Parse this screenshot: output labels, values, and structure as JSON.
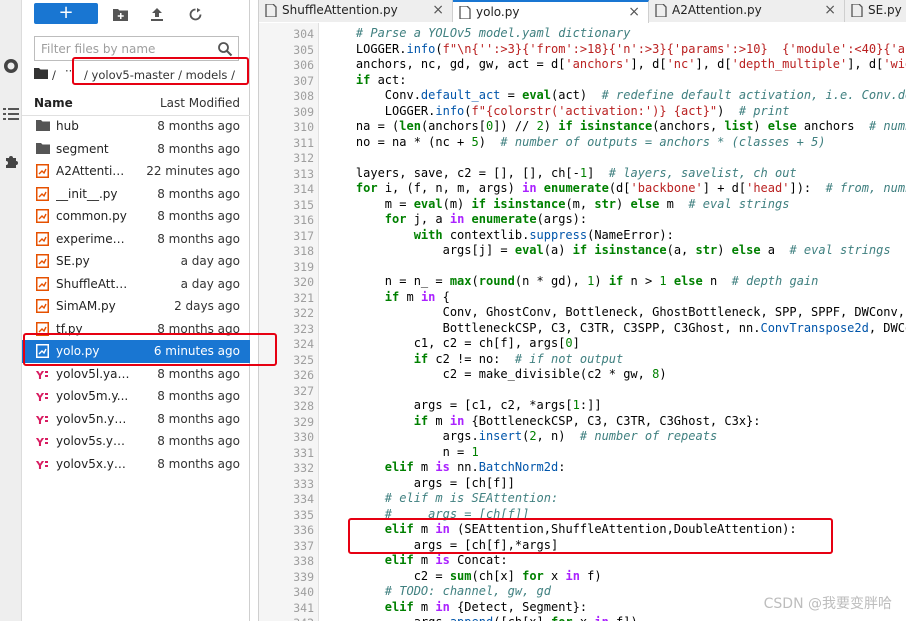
{
  "browser": {
    "search_placeholder": "Filter files by name",
    "breadcrumb": {
      "root": "/",
      "ellipsis": "··",
      "path": "/ yolov5-master / models /"
    },
    "header": {
      "name": "Name",
      "modified": "Last Modified"
    },
    "files": [
      {
        "name": "hub",
        "type": "folder",
        "modified": "8 months ago"
      },
      {
        "name": "segment",
        "type": "folder",
        "modified": "8 months ago"
      },
      {
        "name": "A2Attentio...",
        "type": "python",
        "modified": "22 minutes ago"
      },
      {
        "name": "__init__.py",
        "type": "python",
        "modified": "8 months ago"
      },
      {
        "name": "common.py",
        "type": "python",
        "modified": "8 months ago"
      },
      {
        "name": "experimen...",
        "type": "python",
        "modified": "8 months ago"
      },
      {
        "name": "SE.py",
        "type": "python",
        "modified": "a day ago"
      },
      {
        "name": "ShuffleAtte...",
        "type": "python",
        "modified": "a day ago"
      },
      {
        "name": "SimAM.py",
        "type": "python",
        "modified": "2 days ago"
      },
      {
        "name": "tf.py",
        "type": "python",
        "modified": "8 months ago"
      },
      {
        "name": "yolo.py",
        "type": "python",
        "modified": "6 minutes ago",
        "selected": true
      },
      {
        "name": "yolov5l.yaml",
        "type": "yaml",
        "modified": "8 months ago"
      },
      {
        "name": "yolov5m.y...",
        "type": "yaml",
        "modified": "8 months ago"
      },
      {
        "name": "yolov5n.yaml",
        "type": "yaml",
        "modified": "8 months ago"
      },
      {
        "name": "yolov5s.yaml",
        "type": "yaml",
        "modified": "8 months ago"
      },
      {
        "name": "yolov5x.yaml",
        "type": "yaml",
        "modified": "8 months ago"
      }
    ]
  },
  "editor": {
    "tabs": [
      {
        "label": "ShuffleAttention.py",
        "close": "×",
        "active": false
      },
      {
        "label": "yolo.py",
        "close": "×",
        "active": true
      },
      {
        "label": "A2Attention.py",
        "close": "×",
        "active": false
      },
      {
        "label": "SE.py",
        "close": "",
        "active": false
      }
    ],
    "lines": [
      {
        "n": "304",
        "segs": [
          [
            "    ",
            ""
          ],
          [
            "# Parse a YOLOv5 model.yaml dictionary",
            "cm"
          ]
        ]
      },
      {
        "n": "305",
        "segs": [
          [
            "    LOGGER.",
            ""
          ],
          [
            "info",
            "fn"
          ],
          [
            "(",
            ""
          ],
          [
            "f\"\\n{'':>3}{'from':>18}{'n':>3}{'params':>10}  {'module':<40}{'argumen",
            "st"
          ]
        ]
      },
      {
        "n": "306",
        "segs": [
          [
            "    anchors, nc, gd, gw, act = d[",
            ""
          ],
          [
            "'anchors'",
            "st"
          ],
          [
            "], d[",
            ""
          ],
          [
            "'nc'",
            "st"
          ],
          [
            "], d[",
            ""
          ],
          [
            "'depth_multiple'",
            "st"
          ],
          [
            "], d[",
            ""
          ],
          [
            "'width_mu",
            "st"
          ]
        ]
      },
      {
        "n": "307",
        "segs": [
          [
            "    ",
            ""
          ],
          [
            "if",
            "kw"
          ],
          [
            " act:",
            ""
          ]
        ]
      },
      {
        "n": "308",
        "segs": [
          [
            "        Conv.",
            ""
          ],
          [
            "default_act",
            "fn"
          ],
          [
            " = ",
            ""
          ],
          [
            "eval",
            "kw"
          ],
          [
            "(act)  ",
            ""
          ],
          [
            "# redefine default activation, i.e. Conv.default",
            "cm"
          ]
        ]
      },
      {
        "n": "309",
        "segs": [
          [
            "        LOGGER.",
            ""
          ],
          [
            "info",
            "fn"
          ],
          [
            "(",
            ""
          ],
          [
            "f\"{colorstr('activation:')} {act}\"",
            "st"
          ],
          [
            ")  ",
            ""
          ],
          [
            "# print",
            "cm"
          ]
        ]
      },
      {
        "n": "310",
        "segs": [
          [
            "    na = (",
            ""
          ],
          [
            "len",
            "kw"
          ],
          [
            "(anchors[",
            ""
          ],
          [
            "0",
            "nu"
          ],
          [
            "]) // ",
            ""
          ],
          [
            "2",
            "nu"
          ],
          [
            ") ",
            ""
          ],
          [
            "if",
            "kw"
          ],
          [
            " ",
            ""
          ],
          [
            "isinstance",
            "kw"
          ],
          [
            "(anchors, ",
            ""
          ],
          [
            "list",
            "kw"
          ],
          [
            ") ",
            ""
          ],
          [
            "else",
            "kw"
          ],
          [
            " anchors  ",
            ""
          ],
          [
            "# number o",
            "cm"
          ]
        ]
      },
      {
        "n": "311",
        "segs": [
          [
            "    no = na * (nc + ",
            ""
          ],
          [
            "5",
            "nu"
          ],
          [
            ")  ",
            ""
          ],
          [
            "# number of outputs = anchors * (classes + 5)",
            "cm"
          ]
        ]
      },
      {
        "n": "312",
        "segs": [
          [
            "",
            ""
          ]
        ]
      },
      {
        "n": "313",
        "segs": [
          [
            "    layers, save, c2 = [], [], ch[-",
            ""
          ],
          [
            "1",
            "nu"
          ],
          [
            "]  ",
            ""
          ],
          [
            "# layers, savelist, ch out",
            "cm"
          ]
        ]
      },
      {
        "n": "314",
        "segs": [
          [
            "    ",
            ""
          ],
          [
            "for",
            "kw"
          ],
          [
            " i, (f, n, m, args) ",
            ""
          ],
          [
            "in",
            "op"
          ],
          [
            " ",
            ""
          ],
          [
            "enumerate",
            "kw"
          ],
          [
            "(d[",
            ""
          ],
          [
            "'backbone'",
            "st"
          ],
          [
            "] + d[",
            ""
          ],
          [
            "'head'",
            "st"
          ],
          [
            "]):  ",
            ""
          ],
          [
            "# from, number, m",
            "cm"
          ]
        ]
      },
      {
        "n": "315",
        "segs": [
          [
            "        m = ",
            ""
          ],
          [
            "eval",
            "kw"
          ],
          [
            "(m) ",
            ""
          ],
          [
            "if",
            "kw"
          ],
          [
            " ",
            ""
          ],
          [
            "isinstance",
            "kw"
          ],
          [
            "(m, ",
            ""
          ],
          [
            "str",
            "kw"
          ],
          [
            ") ",
            ""
          ],
          [
            "else",
            "kw"
          ],
          [
            " m  ",
            ""
          ],
          [
            "# eval strings",
            "cm"
          ]
        ]
      },
      {
        "n": "316",
        "segs": [
          [
            "        ",
            ""
          ],
          [
            "for",
            "kw"
          ],
          [
            " j, a ",
            ""
          ],
          [
            "in",
            "op"
          ],
          [
            " ",
            ""
          ],
          [
            "enumerate",
            "kw"
          ],
          [
            "(args):",
            ""
          ]
        ]
      },
      {
        "n": "317",
        "segs": [
          [
            "            ",
            ""
          ],
          [
            "with",
            "kw"
          ],
          [
            " contextlib.",
            ""
          ],
          [
            "suppress",
            "fn"
          ],
          [
            "(NameError):",
            ""
          ]
        ]
      },
      {
        "n": "318",
        "segs": [
          [
            "                args[j] = ",
            ""
          ],
          [
            "eval",
            "kw"
          ],
          [
            "(a) ",
            ""
          ],
          [
            "if",
            "kw"
          ],
          [
            " ",
            ""
          ],
          [
            "isinstance",
            "kw"
          ],
          [
            "(a, ",
            ""
          ],
          [
            "str",
            "kw"
          ],
          [
            ") ",
            ""
          ],
          [
            "else",
            "kw"
          ],
          [
            " a  ",
            ""
          ],
          [
            "# eval strings",
            "cm"
          ]
        ]
      },
      {
        "n": "319",
        "segs": [
          [
            "",
            ""
          ]
        ]
      },
      {
        "n": "320",
        "segs": [
          [
            "        n = n_ = ",
            ""
          ],
          [
            "max",
            "kw"
          ],
          [
            "(",
            ""
          ],
          [
            "round",
            "kw"
          ],
          [
            "(n * gd), ",
            ""
          ],
          [
            "1",
            "nu"
          ],
          [
            ") ",
            ""
          ],
          [
            "if",
            "kw"
          ],
          [
            " n > ",
            ""
          ],
          [
            "1",
            "nu"
          ],
          [
            " ",
            ""
          ],
          [
            "else",
            "kw"
          ],
          [
            " n  ",
            ""
          ],
          [
            "# depth gain",
            "cm"
          ]
        ]
      },
      {
        "n": "321",
        "segs": [
          [
            "        ",
            ""
          ],
          [
            "if",
            "kw"
          ],
          [
            " m ",
            ""
          ],
          [
            "in",
            "op"
          ],
          [
            " {",
            ""
          ]
        ]
      },
      {
        "n": "322",
        "segs": [
          [
            "                Conv, GhostConv, Bottleneck, GhostBottleneck, SPP, SPPF, DWConv, MixCo",
            ""
          ]
        ]
      },
      {
        "n": "323",
        "segs": [
          [
            "                BottleneckCSP, C3, C3TR, C3SPP, C3Ghost, nn.",
            ""
          ],
          [
            "ConvTranspose2d",
            "fn"
          ],
          [
            ", DWConvTra",
            ""
          ]
        ]
      },
      {
        "n": "324",
        "segs": [
          [
            "            c1, c2 = ch[f], args[",
            ""
          ],
          [
            "0",
            "nu"
          ],
          [
            "]",
            ""
          ]
        ]
      },
      {
        "n": "325",
        "segs": [
          [
            "            ",
            ""
          ],
          [
            "if",
            "kw"
          ],
          [
            " c2 != no:  ",
            ""
          ],
          [
            "# if not output",
            "cm"
          ]
        ]
      },
      {
        "n": "326",
        "segs": [
          [
            "                c2 = make_divisible(c2 * gw, ",
            ""
          ],
          [
            "8",
            "nu"
          ],
          [
            ")",
            ""
          ]
        ]
      },
      {
        "n": "327",
        "segs": [
          [
            "",
            ""
          ]
        ]
      },
      {
        "n": "328",
        "segs": [
          [
            "            args = [c1, c2, *args[",
            ""
          ],
          [
            "1",
            "nu"
          ],
          [
            ":]]",
            ""
          ]
        ]
      },
      {
        "n": "329",
        "segs": [
          [
            "            ",
            ""
          ],
          [
            "if",
            "kw"
          ],
          [
            " m ",
            ""
          ],
          [
            "in",
            "op"
          ],
          [
            " {BottleneckCSP, C3, C3TR, C3Ghost, C3x}:",
            ""
          ]
        ]
      },
      {
        "n": "330",
        "segs": [
          [
            "                args.",
            ""
          ],
          [
            "insert",
            "fn"
          ],
          [
            "(",
            ""
          ],
          [
            "2",
            "nu"
          ],
          [
            ", n)  ",
            ""
          ],
          [
            "# number of repeats",
            "cm"
          ]
        ]
      },
      {
        "n": "331",
        "segs": [
          [
            "                n = ",
            ""
          ],
          [
            "1",
            "nu"
          ]
        ]
      },
      {
        "n": "332",
        "segs": [
          [
            "        ",
            ""
          ],
          [
            "elif",
            "kw"
          ],
          [
            " m ",
            ""
          ],
          [
            "is",
            "op"
          ],
          [
            " nn.",
            ""
          ],
          [
            "BatchNorm2d",
            "fn"
          ],
          [
            ":",
            ""
          ]
        ]
      },
      {
        "n": "333",
        "segs": [
          [
            "            args = [ch[f]]",
            ""
          ]
        ]
      },
      {
        "n": "334",
        "segs": [
          [
            "        ",
            ""
          ],
          [
            "# elif m is SEAttention:",
            "cm"
          ]
        ]
      },
      {
        "n": "335",
        "segs": [
          [
            "        ",
            ""
          ],
          [
            "#     args = [ch[f]]",
            "cm"
          ]
        ]
      },
      {
        "n": "336",
        "segs": [
          [
            "        ",
            ""
          ],
          [
            "elif",
            "kw"
          ],
          [
            " m ",
            ""
          ],
          [
            "in",
            "op"
          ],
          [
            " (SEAttention,ShuffleAttention,DoubleAttention):",
            ""
          ]
        ]
      },
      {
        "n": "337",
        "segs": [
          [
            "            args = [ch[f],*args]",
            ""
          ]
        ]
      },
      {
        "n": "338",
        "segs": [
          [
            "        ",
            ""
          ],
          [
            "elif",
            "kw"
          ],
          [
            " m ",
            ""
          ],
          [
            "is",
            "op"
          ],
          [
            " Concat:",
            ""
          ]
        ]
      },
      {
        "n": "339",
        "segs": [
          [
            "            c2 = ",
            ""
          ],
          [
            "sum",
            "kw"
          ],
          [
            "(ch[x] ",
            ""
          ],
          [
            "for",
            "kw"
          ],
          [
            " x ",
            ""
          ],
          [
            "in",
            "op"
          ],
          [
            " f)",
            ""
          ]
        ]
      },
      {
        "n": "340",
        "segs": [
          [
            "        ",
            ""
          ],
          [
            "# TODO: channel, gw, gd",
            "cm"
          ]
        ]
      },
      {
        "n": "341",
        "segs": [
          [
            "        ",
            ""
          ],
          [
            "elif",
            "kw"
          ],
          [
            " m ",
            ""
          ],
          [
            "in",
            "op"
          ],
          [
            " {Detect, Segment}:",
            ""
          ]
        ]
      },
      {
        "n": "342",
        "segs": [
          [
            "            args.",
            ""
          ],
          [
            "append",
            "fn"
          ],
          [
            "([ch[x] ",
            ""
          ],
          [
            "for",
            "kw"
          ],
          [
            " x ",
            ""
          ],
          [
            "in",
            "op"
          ],
          [
            " f])",
            ""
          ]
        ]
      }
    ]
  },
  "colors": {
    "accent": "#1976d2",
    "highlight_box": "#e60012",
    "python_icon": "#e65100",
    "yaml_icon": "#d81b60"
  },
  "watermark": "CSDN @我要变胖哈"
}
